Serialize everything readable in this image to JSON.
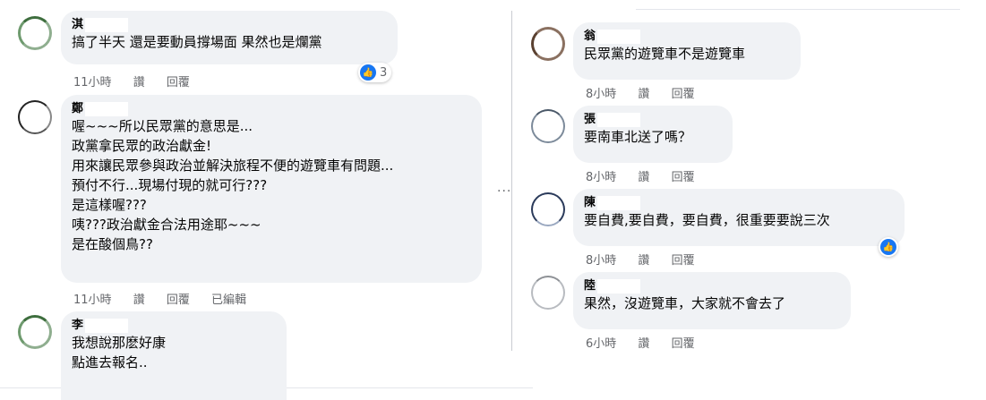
{
  "left_comments": [
    {
      "name_initial": "淇",
      "text": "搞了半天 還是要動員撐場面 果然也是爛黨",
      "time": "11小時",
      "like": "讚",
      "reply": "回覆",
      "edited": "",
      "reactions": "3"
    },
    {
      "name_initial": "鄭",
      "text": "喔~~~所以民眾黨的意思是...\n政黨拿民眾的政治獻金!\n用來讓民眾參與政治並解決旅程不便的遊覽車有問題...\n預付不行...現場付現的就可行???\n是這樣喔???\n咦???政治獻金合法用途耶~~~\n是在酸個鳥??",
      "time": "11小時",
      "like": "讚",
      "reply": "回覆",
      "edited": "已編輯"
    },
    {
      "name_initial": "李",
      "text": "我想說那麽好康\n點進去報名..",
      "time": "",
      "like": "",
      "reply": "",
      "edited": ""
    }
  ],
  "right_comments": [
    {
      "name_initial": "翁",
      "text": "民眾黨的遊覽車不是遊覽車",
      "time": "8小時",
      "like": "讚",
      "reply": "回覆"
    },
    {
      "name_initial": "張",
      "text": "要南車北送了嗎？",
      "time": "8小時",
      "like": "讚",
      "reply": "回覆"
    },
    {
      "name_initial": "陳",
      "text": "要自費,要自費，要自費，很重要要說三次",
      "time": "8小時",
      "like": "讚",
      "reply": "回覆"
    },
    {
      "name_initial": "陸",
      "text": "果然，沒遊覽車，大家就不會去了",
      "time": "6小時",
      "like": "讚",
      "reply": "回覆"
    }
  ],
  "more_menu": "···",
  "colors": {
    "bubble": "#f0f2f5",
    "meta": "#65676b",
    "like_blue": "#1877f2"
  },
  "icons": {
    "like_reaction": "thumbs-up-icon",
    "more": "more-horizontal-icon"
  }
}
